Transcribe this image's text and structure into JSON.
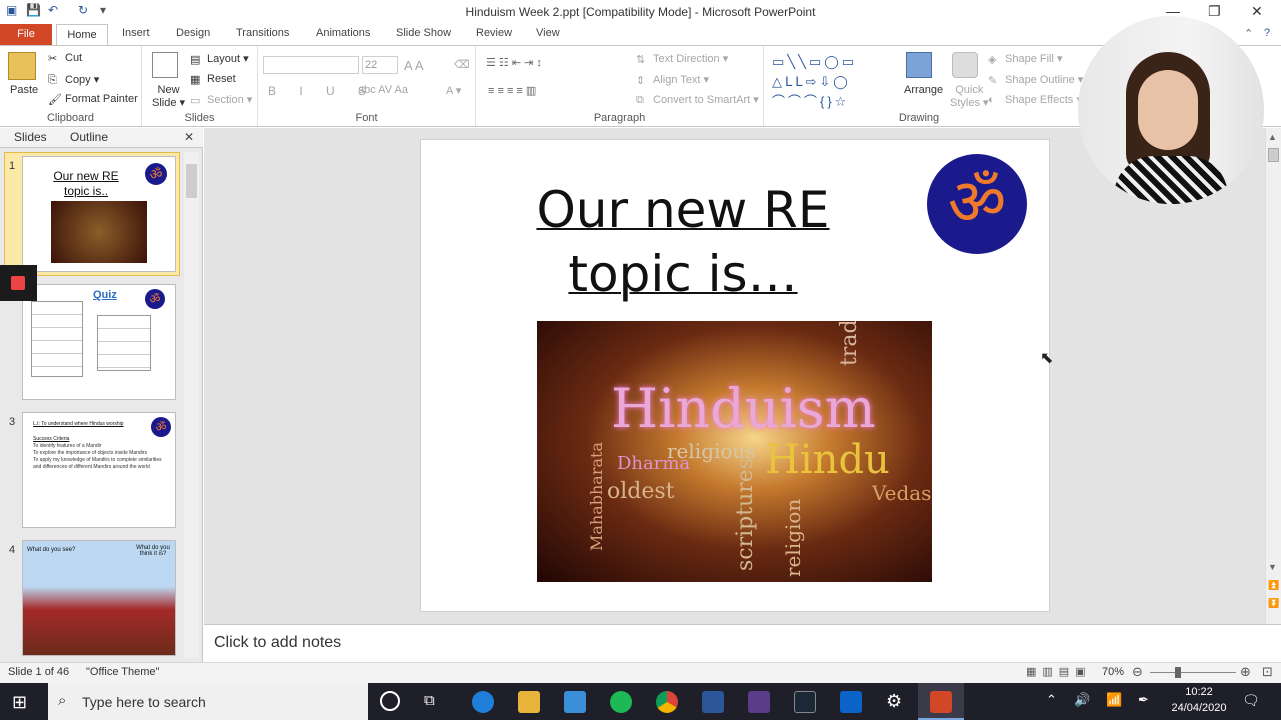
{
  "window": {
    "title": "Hinduism Week 2.ppt [Compatibility Mode] - Microsoft PowerPoint"
  },
  "ribbon_tabs": [
    "File",
    "Home",
    "Insert",
    "Design",
    "Transitions",
    "Animations",
    "Slide Show",
    "Review",
    "View"
  ],
  "clipboard": {
    "paste": "Paste",
    "cut": "Cut",
    "copy": "Copy",
    "format_painter": "Format Painter",
    "label": "Clipboard"
  },
  "slides_group": {
    "new_slide_1": "New",
    "new_slide_2": "Slide",
    "layout": "Layout",
    "reset": "Reset",
    "section": "Section",
    "label": "Slides"
  },
  "font_group": {
    "font_size": "22",
    "label": "Font"
  },
  "paragraph_group": {
    "text_direction": "Text Direction",
    "align_text": "Align Text",
    "convert_smartart": "Convert to SmartArt",
    "label": "Paragraph"
  },
  "drawing_group": {
    "arrange": "Arrange",
    "quick_1": "Quick",
    "quick_2": "Styles",
    "shape_fill": "Shape Fill",
    "shape_outline": "Shape Outline",
    "shape_effects": "Shape Effects",
    "label": "Drawing"
  },
  "pane_tabs": {
    "slides": "Slides",
    "outline": "Outline"
  },
  "thumbnails": [
    {
      "num": "1",
      "title": "Our new RE topic is.."
    },
    {
      "num": "2",
      "title": "Quiz"
    },
    {
      "num": "3",
      "line1": "L.I: To understand where Hindus worship",
      "line2": "Success Criteria",
      "line3": "To identify features of a Mandir",
      "line4": "To explore the importance of objects inside Mandirs",
      "line5": "To apply my knowledge of Mandirs to complete similarities and differences of different Mandirs around the world"
    },
    {
      "num": "4",
      "left": "What do you see?",
      "right": "What do you think it is?"
    }
  ],
  "slide": {
    "title_line1": "Our new RE",
    "title_line2": "topic is…",
    "word_main": "Hinduism",
    "word_2": "Hindu",
    "word_3": "religious",
    "word_4": "Dharma",
    "word_5": "scriptures",
    "word_6": "tradition",
    "word_7": "Vedas",
    "word_8": "Mahabharata",
    "word_9": "oldest",
    "word_10": "religion"
  },
  "notes": {
    "placeholder": "Click to add notes"
  },
  "status": {
    "slide": "Slide 1 of 46",
    "theme": "\"Office Theme\"",
    "zoom": "70%"
  },
  "taskbar": {
    "search": "Type here to search",
    "time": "10:22",
    "date": "24/04/2020"
  },
  "colors": {
    "file_tab": "#d24726",
    "om_circle": "#1a1a8c",
    "om_symbol": "#f07a2b",
    "taskbar": "#1f1f2a"
  }
}
